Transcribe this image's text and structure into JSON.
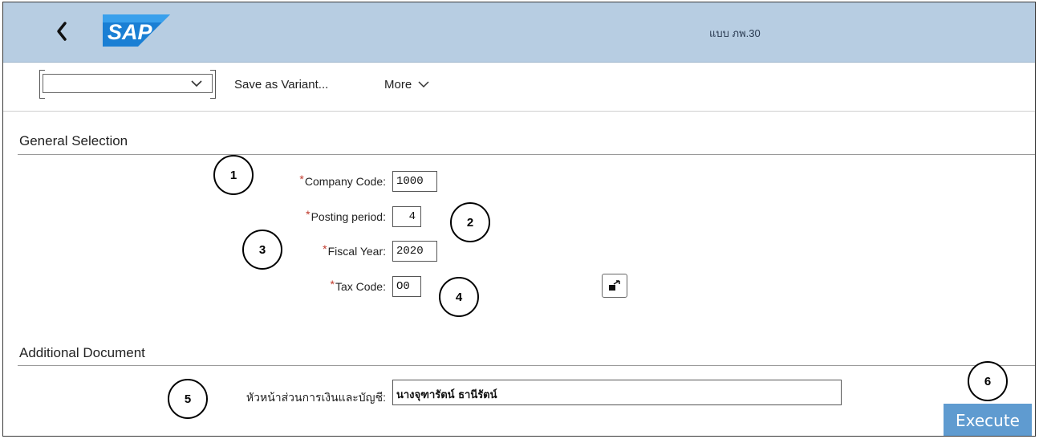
{
  "shell": {
    "title": "แบบ ภพ.30",
    "logo_text": "SAP"
  },
  "toolbar": {
    "variant_value": "",
    "save_variant_label": "Save as Variant...",
    "more_label": "More"
  },
  "general_selection": {
    "title": "General Selection",
    "fields": [
      {
        "label": "Company Code:",
        "required": "*",
        "value": "1000"
      },
      {
        "label": "Posting period:",
        "required": "*",
        "value": "4"
      },
      {
        "label": "Fiscal Year:",
        "required": "*",
        "value": "2020"
      },
      {
        "label": "Tax Code:",
        "required": "*",
        "value": "O0"
      }
    ]
  },
  "additional_document": {
    "title": "Additional Document",
    "field_label": "หัวหน้าส่วนการเงินและบัญชี:",
    "field_value": "นางจุฑารัตน์ ธานีรัตน์"
  },
  "annotations": [
    "1",
    "2",
    "3",
    "4",
    "5",
    "6"
  ],
  "execute_label": "Execute"
}
